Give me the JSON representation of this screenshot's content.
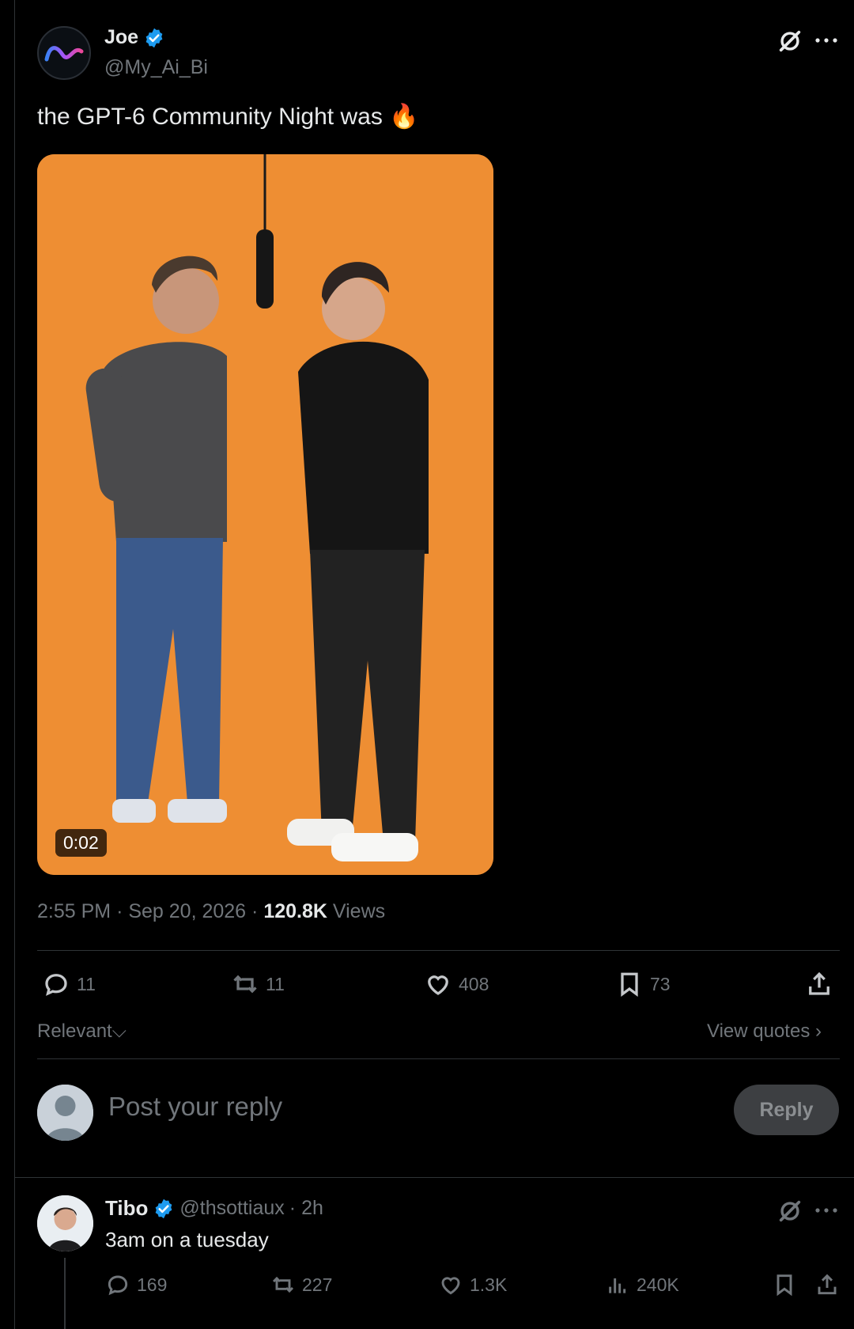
{
  "post": {
    "author_name": "Joe",
    "author_handle": "@My_Ai_Bi",
    "text": "the GPT-6 Community Night was 🔥",
    "video_duration": "0:02",
    "time": "2:55 PM",
    "date": "Sep 20, 2026",
    "views_count": "120.8K",
    "views_label": "Views",
    "separator": "·"
  },
  "stats": {
    "replies": "11",
    "reposts": "11",
    "likes": "408",
    "bookmarks": "73"
  },
  "sort": {
    "label": "Relevant",
    "view_quotes": "View quotes"
  },
  "composer": {
    "placeholder": "Post your reply",
    "button_label": "Reply"
  },
  "comment": {
    "author_name": "Tibo",
    "author_handle": "@thsottiaux",
    "time": "· 2h",
    "text": "3am on a tuesday",
    "replies": "169",
    "reposts": "227",
    "likes": "1.3K",
    "views": "240K"
  },
  "colors": {
    "background": "#000000",
    "verified": "#1d9bf0",
    "muted": "#71767b",
    "media_bg": "#ee8e33"
  }
}
